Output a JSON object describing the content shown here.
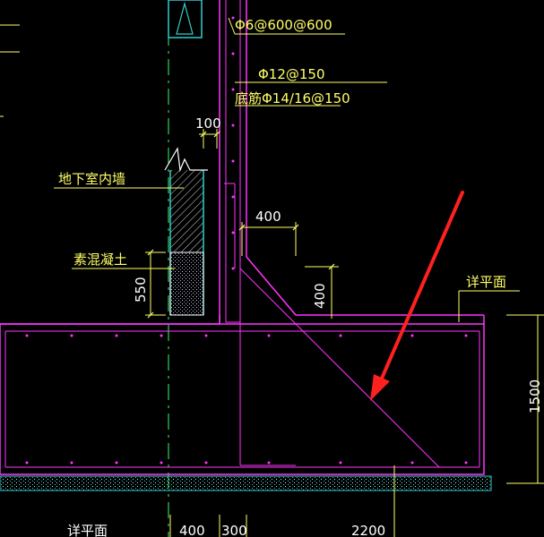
{
  "drawing": {
    "labels": {
      "rebar_top": "Φ6@600@600",
      "rebar_mid": "Φ12@150",
      "rebar_main": "底筋Φ14/16@150",
      "inner_wall": "地下室内墙",
      "plain_concrete": "素混凝土",
      "detail_plan_right": "详平面",
      "detail_plan_bottom": "详平面"
    },
    "dimensions": {
      "d100": "100",
      "d400_horizontal": "400",
      "d400_vertical": "400",
      "d550": "550",
      "d1500": "1500",
      "b400": "400",
      "b300": "300",
      "b2200": "2200"
    },
    "colors": {
      "background": "#000000",
      "concrete_outline": "#ff33ff",
      "rebar": "#ff33ff",
      "dimension": "#ffff66",
      "centerline": "#33ff66",
      "wall": "#33cccc",
      "annotation_arrow": "#ff2020",
      "cushion": "#33cccc"
    }
  }
}
